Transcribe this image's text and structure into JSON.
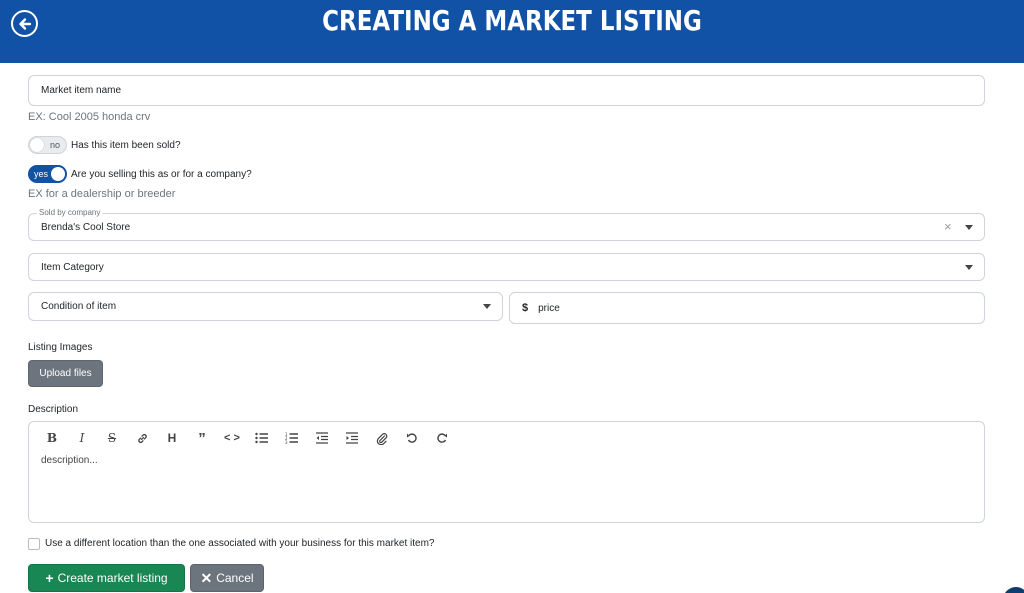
{
  "header": {
    "title": "CREATING A MARKET LISTING",
    "back_icon": "arrow-left-circle-icon"
  },
  "form": {
    "item_name": {
      "placeholder": "Market item name",
      "helper": "EX: Cool 2005 honda crv"
    },
    "sold_toggle": {
      "state": "no",
      "label": "Has this item been sold?"
    },
    "company_toggle": {
      "state": "yes",
      "label": "Are you selling this as or for a company?",
      "helper": "EX for a dealership or breeder"
    },
    "sold_by_company": {
      "float_label": "Sold by company",
      "value": "Brenda's Cool Store",
      "clear": "×"
    },
    "item_category": {
      "placeholder": "Item Category"
    },
    "condition": {
      "placeholder": "Condition of item"
    },
    "price": {
      "prefix": "$",
      "placeholder": "price"
    },
    "listing_images": {
      "label": "Listing Images",
      "button": "Upload files"
    },
    "description": {
      "label": "Description",
      "placeholder": "description...",
      "toolbar": [
        "bold",
        "italic",
        "strikethrough",
        "link",
        "heading",
        "quote",
        "code",
        "bullet-list",
        "numbered-list",
        "outdent",
        "indent",
        "attachment",
        "undo",
        "redo"
      ]
    },
    "location_checkbox": {
      "label": "Use a different location than the one associated with your business for this market item?"
    }
  },
  "actions": {
    "create": "Create market listing",
    "cancel": "Cancel"
  },
  "colors": {
    "header": "#1151a6",
    "create": "#198754",
    "cancel": "#6c757d"
  }
}
